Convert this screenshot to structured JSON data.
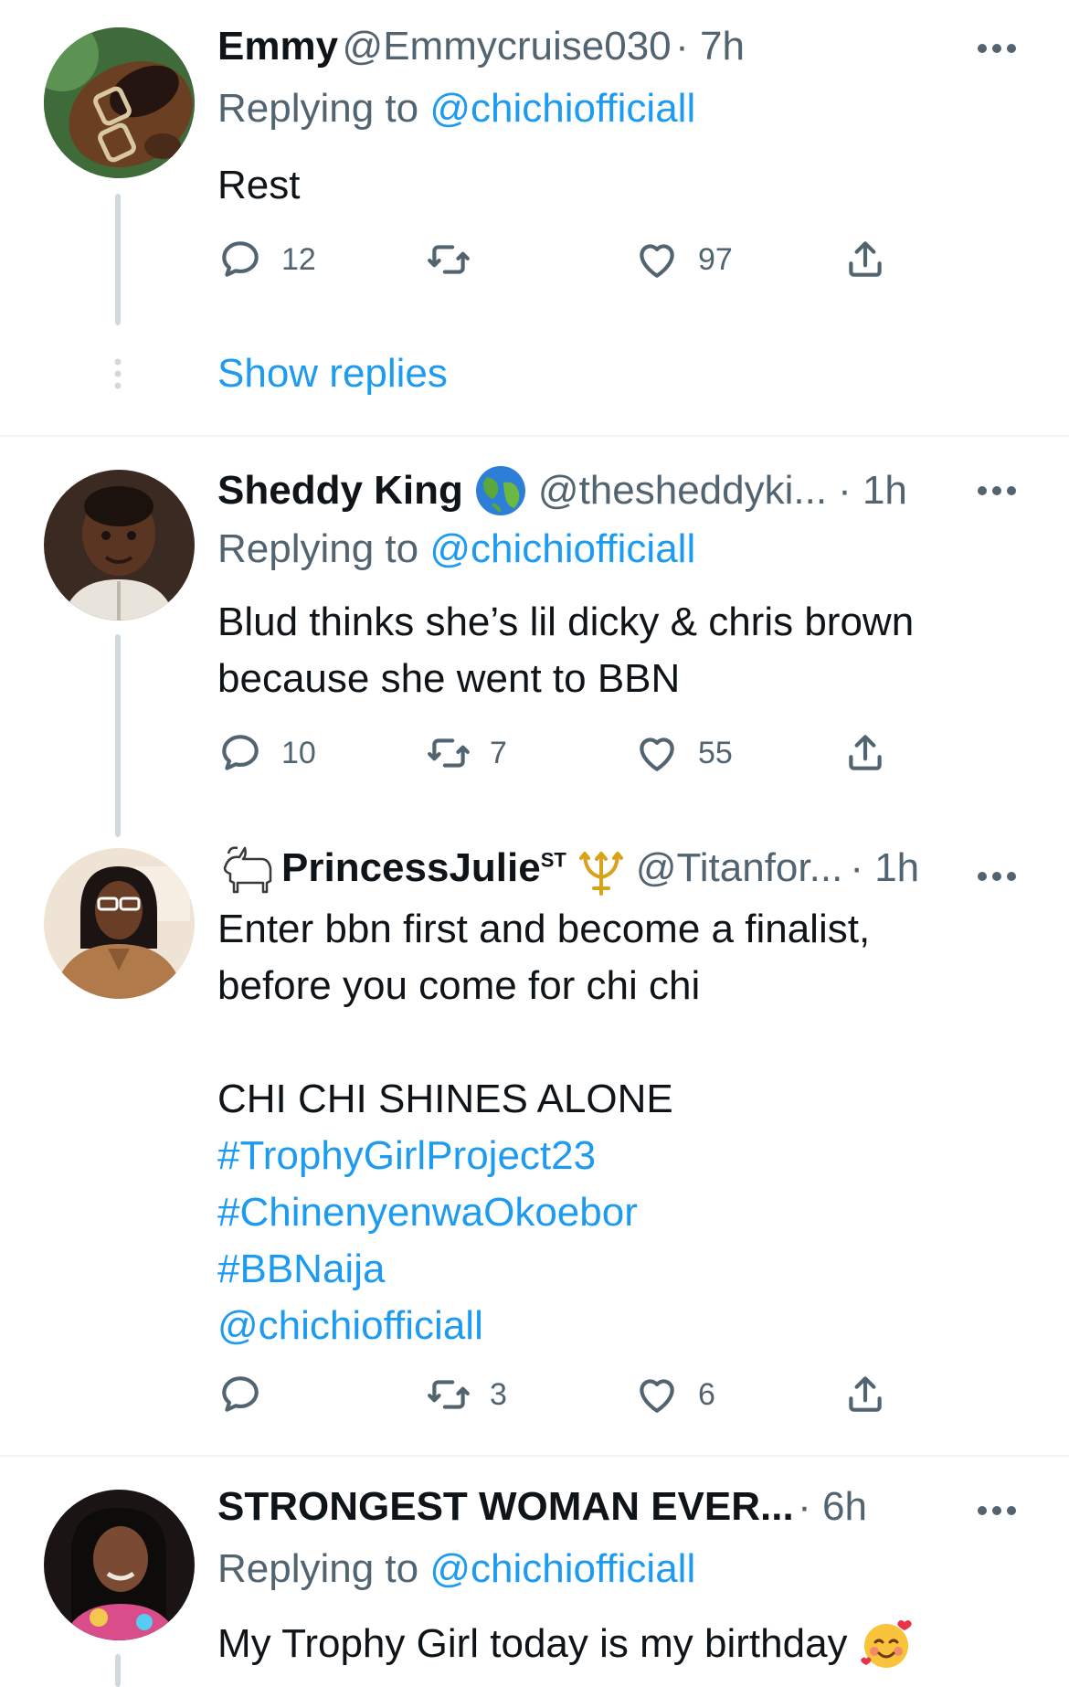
{
  "colors": {
    "accent": "#1d9bf0",
    "muted": "#536471",
    "text": "#0f1419",
    "line": "#cfd9de"
  },
  "replying_prefix": "Replying to",
  "show_replies": "Show replies",
  "tweets": [
    {
      "name": "Emmy",
      "handle": "@Emmycruise030",
      "time": "· 7h",
      "reply_to": "@chichiofficiall",
      "text": "Rest",
      "replies": "12",
      "retweets": "",
      "likes": "97"
    },
    {
      "name": "Sheddy King",
      "badge": "globe-emoji",
      "handle": "@thesheddyki...",
      "time": "· 1h",
      "reply_to": "@chichiofficiall",
      "text_lines": [
        "Blud thinks she’s lil dicky & chris brown",
        "because she went to BBN"
      ],
      "replies": "10",
      "retweets": "7",
      "likes": "55"
    },
    {
      "name": "PrincessJulie",
      "name_superscript": "ST",
      "badges": [
        "goat-emoji",
        "trident-emoji"
      ],
      "handle": "@Titanfor...",
      "time": "· 1h",
      "text_lines": [
        "Enter bbn first and become a finalist,",
        "before you come for chi chi"
      ],
      "shout": "CHI CHI SHINES ALONE",
      "hashtags": [
        "#TrophyGirlProject23",
        "#ChinenyenwaOkoebor",
        "#BBNaija"
      ],
      "mention": "@chichiofficiall",
      "replies": "",
      "retweets": "3",
      "likes": "6"
    },
    {
      "name": "STRONGEST WOMAN EVER...",
      "time": "· 6h",
      "reply_to": "@chichiofficiall",
      "text": "My Trophy Girl today is my birthday",
      "emoji": "smiling-face-with-hearts-emoji"
    }
  ]
}
